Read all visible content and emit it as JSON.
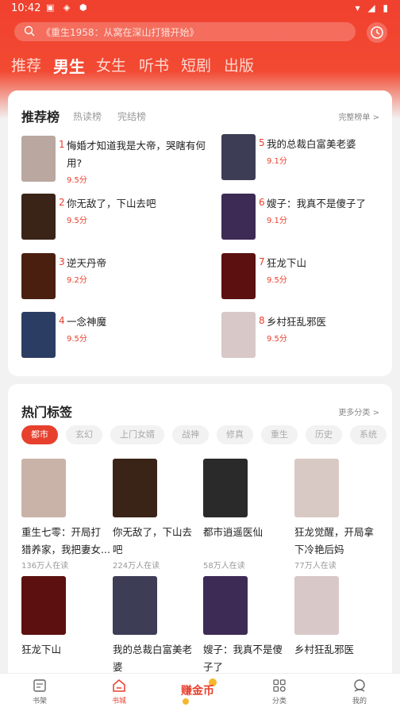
{
  "status": {
    "time": "10:42"
  },
  "search": {
    "placeholder": "《重生1958：从窝在深山打猎开始》"
  },
  "tabs": [
    "推荐",
    "男生",
    "女生",
    "听书",
    "短剧",
    "出版"
  ],
  "rankings": {
    "title": "推荐榜",
    "subtabs": [
      "热读榜",
      "完结榜"
    ],
    "more": "完整榜单 >",
    "items": [
      {
        "num": "1",
        "title": "悔婚才知道我是大帝，哭瞎有何用?",
        "score": "9.5分",
        "cover_color": "#b9a7a0"
      },
      {
        "num": "2",
        "title": "你无敌了，下山去吧",
        "score": "9.5分",
        "cover_color": "#3a2418"
      },
      {
        "num": "3",
        "title": "逆天丹帝",
        "score": "9.2分",
        "cover_color": "#4a1f10"
      },
      {
        "num": "4",
        "title": "一念神魔",
        "score": "9.5分",
        "cover_color": "#2c3d63"
      },
      {
        "num": "5",
        "title": "我的总裁白富美老婆",
        "score": "9.1分",
        "cover_color": "#3d3d55"
      },
      {
        "num": "6",
        "title": "嫂子：我真不是傻子了",
        "score": "9.1分",
        "cover_color": "#3d2a55"
      },
      {
        "num": "7",
        "title": "狂龙下山",
        "score": "9.5分",
        "cover_color": "#5c1010"
      },
      {
        "num": "8",
        "title": "乡村狂乱邪医",
        "score": "9.5分",
        "cover_color": "#d8c8c8"
      }
    ]
  },
  "hot_tags": {
    "title": "热门标签",
    "more": "更多分类 >",
    "chips": [
      "都市",
      "玄幻",
      "上门女婿",
      "战神",
      "修真",
      "重生",
      "历史",
      "系统"
    ],
    "books": [
      {
        "title": "重生七零：开局打猎养家，我把妻女...",
        "readers": "136万人在读",
        "cover_color": "#c9b3a8"
      },
      {
        "title": "你无敌了，下山去吧",
        "readers": "224万人在读",
        "cover_color": "#3a2418"
      },
      {
        "title": "都市逍遥医仙",
        "readers": "58万人在读",
        "cover_color": "#2a2a2a"
      },
      {
        "title": "狂龙觉醒，开局拿下冷艳后妈",
        "readers": "77万人在读",
        "cover_color": "#d9c9c4"
      },
      {
        "title": "狂龙下山",
        "readers": "",
        "cover_color": "#5c1010"
      },
      {
        "title": "我的总裁白富美老婆",
        "readers": "",
        "cover_color": "#3d3d55"
      },
      {
        "title": "嫂子：我真不是傻子了",
        "readers": "",
        "cover_color": "#3d2a55"
      },
      {
        "title": "乡村狂乱邪医",
        "readers": "",
        "cover_color": "#d8c8c8"
      }
    ]
  },
  "bottom_nav": {
    "items": [
      "书架",
      "书城",
      "分类",
      "我的"
    ],
    "earn_label": "赚金币"
  },
  "colors": {
    "brand": "#e8402e",
    "header": "#f0402e"
  }
}
